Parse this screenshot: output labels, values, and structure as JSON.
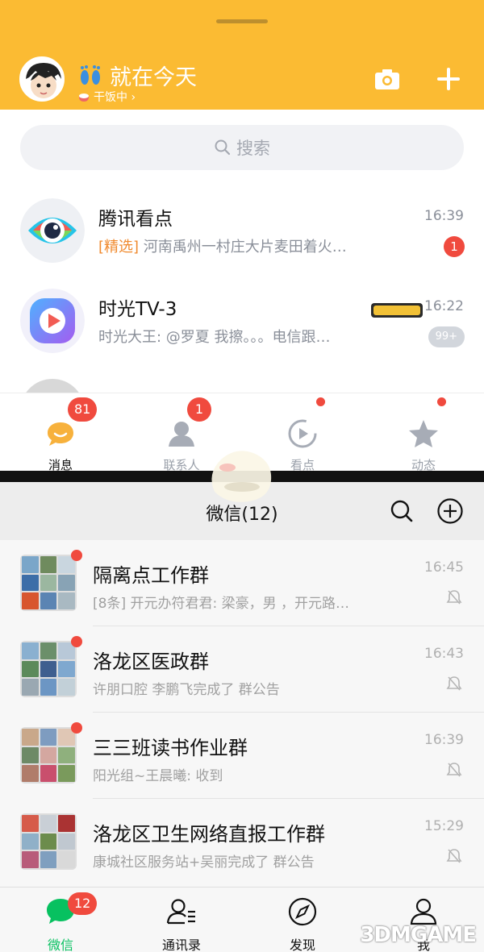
{
  "qq": {
    "header": {
      "nickname": "就在今天",
      "status": "干饭中 ›"
    },
    "search_placeholder": "搜索",
    "chats": [
      {
        "name": "腾讯看点",
        "tag": "[精选]",
        "message": " 河南禹州一村庄大片麦田着火…",
        "time": "16:39",
        "badge": "1"
      },
      {
        "name": "时光TV-3",
        "tag": "",
        "message": "时光大王: @罗夏 我擦。。。电信跟…",
        "time": "16:22",
        "badge": "99+"
      },
      {
        "name": "",
        "tag": "",
        "message": "",
        "time": "",
        "badge": ""
      }
    ],
    "tabs": [
      {
        "label": "消息",
        "badge": "81"
      },
      {
        "label": "联系人",
        "badge": "1"
      },
      {
        "label": "看点",
        "badge": ""
      },
      {
        "label": "动态",
        "badge": ""
      }
    ]
  },
  "wechat": {
    "title": "微信(12)",
    "chats": [
      {
        "name": "隔离点工作群",
        "message": "[8条] 开元办符君君: 梁豪，男 ，开元路…",
        "time": "16:45"
      },
      {
        "name": "洛龙区医政群",
        "message": "许朋口腔 李鹏飞完成了 群公告",
        "time": "16:43"
      },
      {
        "name": "三三班读书作业群",
        "message": "阳光组~王晨曦: 收到",
        "time": "16:39"
      },
      {
        "name": "洛龙区卫生网络直报工作群",
        "message": "康城社区服务站+吴丽完成了 群公告",
        "time": "15:29"
      }
    ],
    "tabs": [
      {
        "label": "微信",
        "badge": "12"
      },
      {
        "label": "通讯录",
        "badge": ""
      },
      {
        "label": "发现",
        "badge": ""
      },
      {
        "label": "我",
        "badge": ""
      }
    ]
  },
  "watermark": "3DMGAME",
  "colors": {
    "qq_header": "#fbbb33",
    "wechat_green": "#07c160",
    "badge_red": "#f04a3e"
  }
}
